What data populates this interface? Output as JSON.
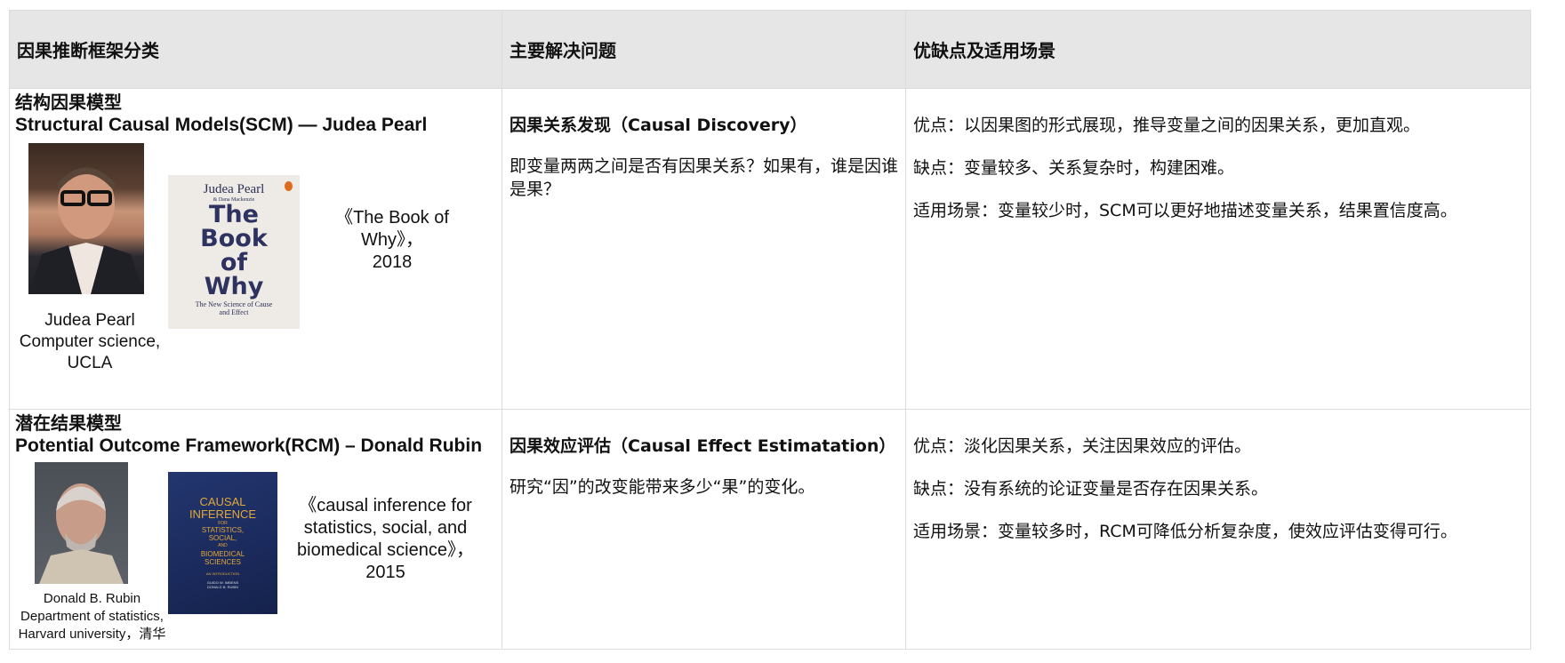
{
  "header": {
    "col1": "因果推断框架分类",
    "col2": "主要解决问题",
    "col3": "优缺点及适用场景"
  },
  "rows": [
    {
      "title_cn": "结构因果模型",
      "title_en": "Structural Causal Models(SCM) — Judea Pearl",
      "person_caption": [
        "Judea Pearl",
        "Computer science,",
        "UCLA"
      ],
      "book_cover": {
        "author": "Judea Pearl",
        "coauthor": "& Dana Mackenzie",
        "title": [
          "The",
          "Book",
          "of",
          "Why"
        ],
        "subtitle": "The New Science of Cause and Effect"
      },
      "book_caption": [
        "《The Book of Why》，",
        "2018"
      ],
      "problem_title": "因果关系发现（Causal Discovery）",
      "problem_desc": "即变量两两之间是否有因果关系？如果有，谁是因谁是果？",
      "pros": "优点：以因果图的形式展现，推导变量之间的因果关系，更加直观。",
      "cons": "缺点：变量较多、关系复杂时，构建困难。",
      "scenario": "适用场景：变量较少时，SCM可以更好地描述变量关系，结果置信度高。"
    },
    {
      "title_cn": "潜在结果模型",
      "title_en": "Potential Outcome Framework(RCM) – Donald Rubin",
      "person_caption": [
        "Donald B. Rubin",
        "Department of statistics,",
        "Harvard university，清华"
      ],
      "book_cover": {
        "title": [
          "CAUSAL",
          "INFERENCE"
        ],
        "for": "FOR",
        "subtitle": [
          "STATISTICS,",
          "SOCIAL,",
          "AND",
          "BIOMEDICAL",
          "SCIENCES"
        ],
        "intro": "AN INTRODUCTION",
        "authors": [
          "GUIDO W. IMBENS",
          "DONALD B. RUBIN"
        ]
      },
      "book_caption": [
        "《causal inference for",
        "statistics, social, and",
        "biomedical science》，",
        "2015"
      ],
      "problem_title": "因果效应评估（Causal Effect Estimatation）",
      "problem_desc": "研究“因”的改变能带来多少“果”的变化。",
      "pros": "优点：淡化因果关系，关注因果效应的评估。",
      "cons": "缺点：没有系统的论证变量是否存在因果关系。",
      "scenario": "适用场景：变量较多时，RCM可降低分析复杂度，使效应评估变得可行。"
    }
  ]
}
